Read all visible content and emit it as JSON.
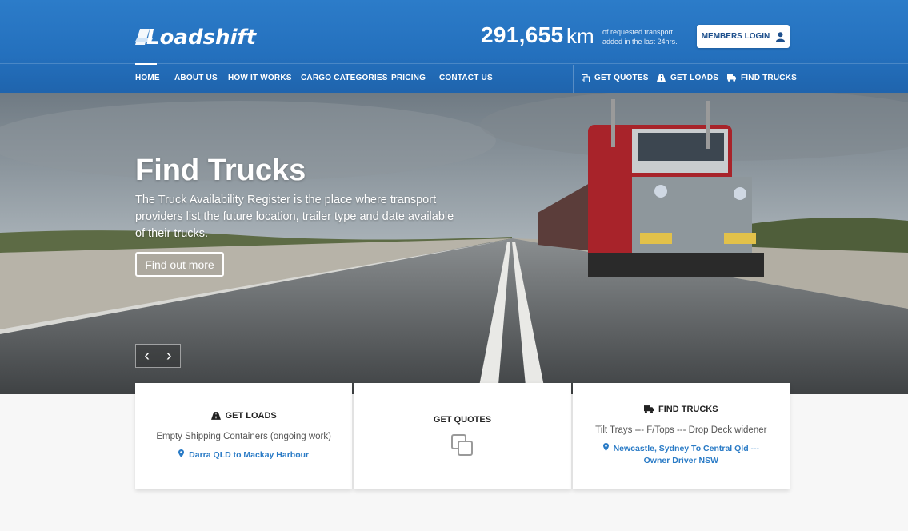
{
  "header": {
    "logo_text": "Loadshift",
    "stat_number": "291,655",
    "stat_unit": "km",
    "stat_desc_line1": "of requested transport",
    "stat_desc_line2": "added in the last 24hrs.",
    "members_login": "MEMBERS LOGIN"
  },
  "nav": {
    "items": [
      "HOME",
      "ABOUT US",
      "HOW IT WORKS",
      "CARGO CATEGORIES",
      "PRICING",
      "CONTACT US"
    ],
    "right": [
      "GET QUOTES",
      "GET LOADS",
      "FIND TRUCKS"
    ]
  },
  "hero": {
    "title": "Find Trucks",
    "text": "The Truck Availability Register is the place where transport providers list the future location, trailer type and date available of their trucks.",
    "button": "Find out more",
    "prev": "‹",
    "next": "›"
  },
  "cards": [
    {
      "title": "GET LOADS",
      "text": "Empty Shipping Containers (ongoing work)",
      "link": "Darra QLD to Mackay Harbour"
    },
    {
      "title": "GET QUOTES"
    },
    {
      "title": "FIND TRUCKS",
      "text": "Tilt Trays --- F/Tops --- Drop Deck widener",
      "link": "Newcastle, Sydney To Central Qld --- Owner Driver NSW"
    }
  ],
  "colors": {
    "brand_blue": "#2470bd",
    "link_blue": "#2a7bc6"
  }
}
